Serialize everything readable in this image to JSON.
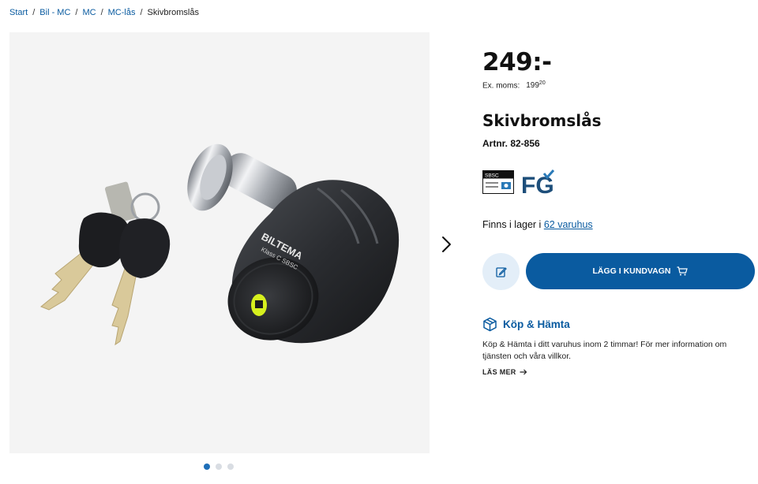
{
  "breadcrumb": {
    "items": [
      "Start",
      "Bil - MC",
      "MC",
      "MC-lås"
    ],
    "separator": "/",
    "current": "Skivbromslås"
  },
  "gallery": {
    "next_icon": "chevron-right-icon",
    "dots_count": 3,
    "active_index": 0,
    "product_brand_text": "BILTEMA",
    "product_class_text": "Klass C  SBSC"
  },
  "product": {
    "price": "249:-",
    "ex_vat_label": "Ex. moms:",
    "ex_vat_value": "199",
    "ex_vat_decimals": "20",
    "title": "Skivbromslås",
    "article_number": "Artnr. 82-856"
  },
  "badges": {
    "sbsc_label": "SBSC",
    "fg_label": "FG"
  },
  "stock": {
    "prefix": "Finns i lager i ",
    "link": "62 varuhus"
  },
  "actions": {
    "add_to_cart": "LÄGG I KUNDVAGN",
    "edit_icon": "edit-icon",
    "cart_icon": "cart-icon"
  },
  "click_collect": {
    "title": "Köp & Hämta",
    "text": "Köp & Hämta i ditt varuhus inom 2 timmar! För mer information om tjänsten och våra villkor.",
    "read_more": "LÄS MER"
  },
  "colors": {
    "brand_blue": "#0a5ba0",
    "light_blue": "#e3eef8",
    "accent_yellow": "#d6f01e"
  }
}
